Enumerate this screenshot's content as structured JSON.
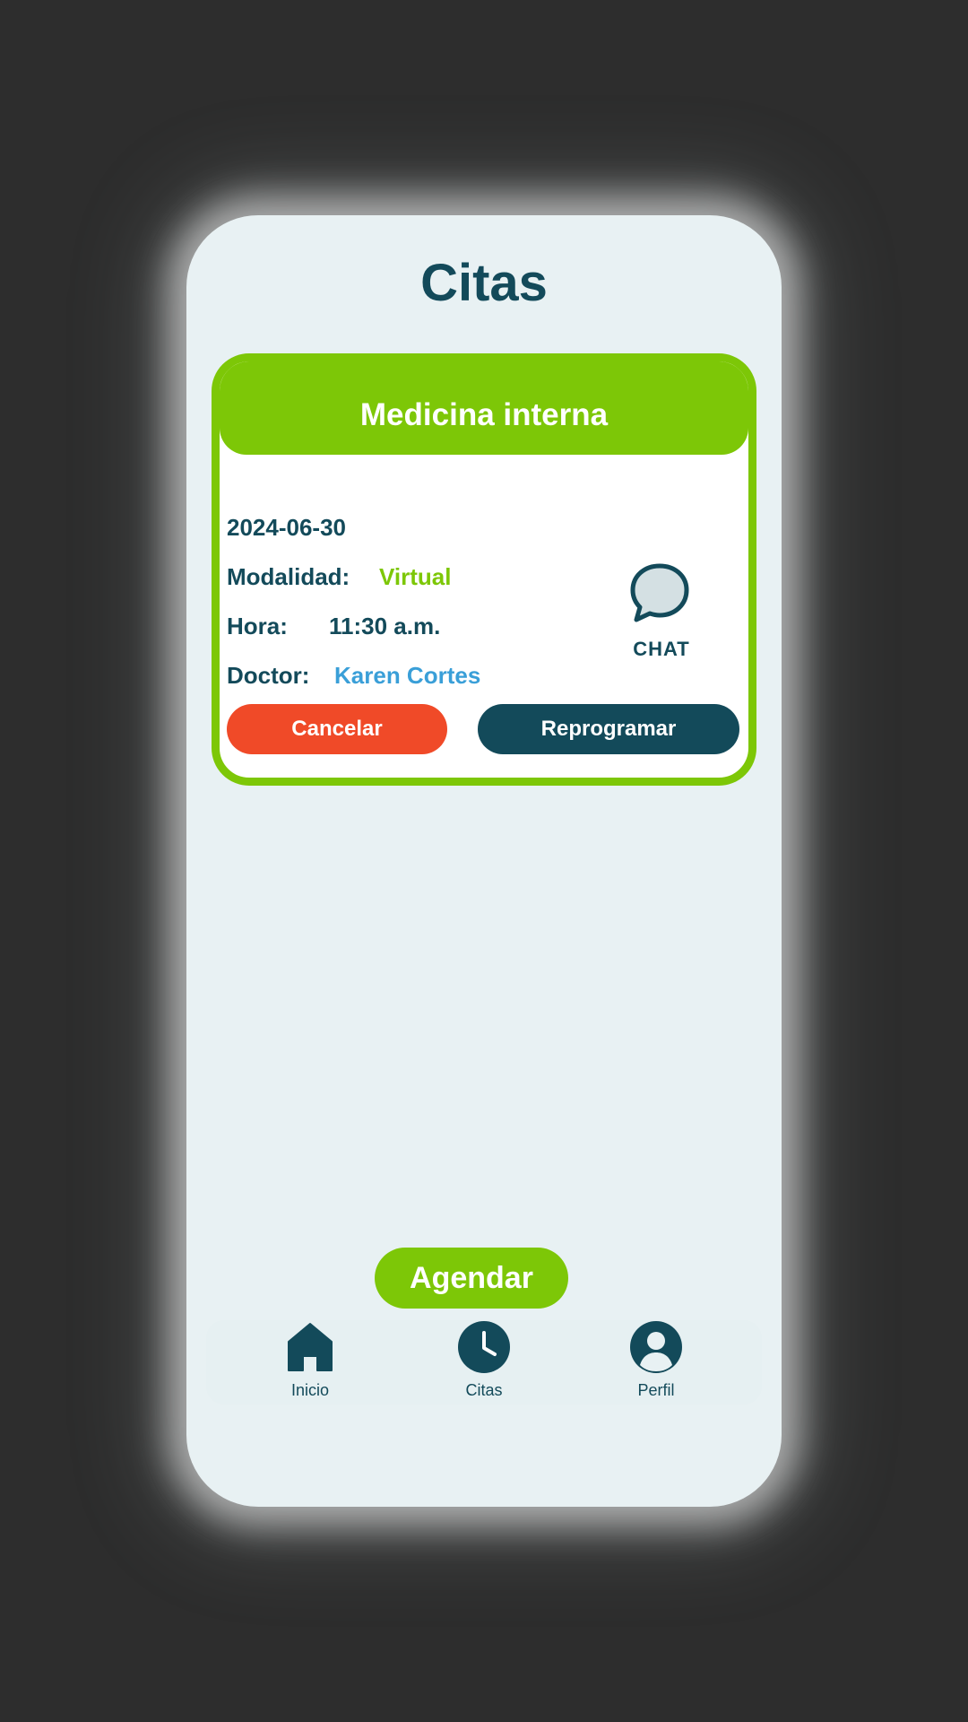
{
  "header": {
    "title": "Citas"
  },
  "appointment": {
    "specialty": "Medicina interna",
    "date": "2024-06-30",
    "modality_label": "Modalidad:",
    "modality_value": "Virtual",
    "time_label": "Hora:",
    "time_value": "11:30 a.m.",
    "doctor_label": "Doctor:",
    "doctor_value": "Karen Cortes",
    "chat_label": "CHAT",
    "cancel_label": "Cancelar",
    "reschedule_label": "Reprogramar"
  },
  "actions": {
    "schedule_label": "Agendar"
  },
  "nav": {
    "items": [
      {
        "label": "Inicio",
        "icon": "home-icon"
      },
      {
        "label": "Citas",
        "icon": "clock-icon"
      },
      {
        "label": "Perfil",
        "icon": "user-icon"
      }
    ]
  },
  "colors": {
    "accent_green": "#7dc707",
    "primary_dark": "#134a5a",
    "danger": "#f04a28",
    "link_blue": "#3a9fd8",
    "screen_bg": "#e8f1f3"
  }
}
